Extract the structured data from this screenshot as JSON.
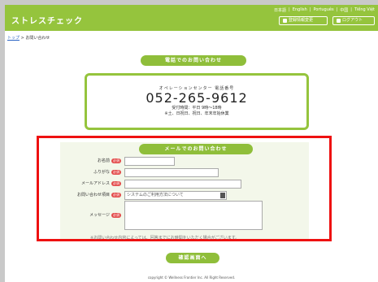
{
  "header": {
    "logo": "ストレスチェック",
    "languages": [
      "日本語",
      "|",
      "English",
      "|",
      "Português",
      "|",
      "中国",
      "|",
      "Tiếng Việt"
    ],
    "buttons": [
      {
        "label": "登録情報変更",
        "icon": "gear-icon"
      },
      {
        "label": "ログアウト",
        "icon": "logout-icon"
      }
    ]
  },
  "breadcrumb": {
    "home": "トップ",
    "separator": " > ",
    "current": "お問い合わせ"
  },
  "phone": {
    "heading": "電話でのお問い合わせ",
    "label": "オペレーションセンター 電話番号",
    "number": "052-265-9612",
    "hours": "受付時間：平日 9時～18時",
    "closed": "※土、日祝日、祝日、年末年始休業"
  },
  "mail": {
    "heading": "メールでのお問い合わせ",
    "required_badge": "必須",
    "fields": {
      "name": "お名前",
      "furigana": "ふりがな",
      "email": "メールアドレス",
      "category": "お問い合わせ項目",
      "message": "メッセージ"
    },
    "category_value": "システムのご利用方法について"
  },
  "notice": "※お問い合わせ内容によっては、回答までにお時間をいただく場合がございます。",
  "submit": "確認画面へ",
  "footer": "copyright © Wellness Frontier Inc. All Right Reserved."
}
